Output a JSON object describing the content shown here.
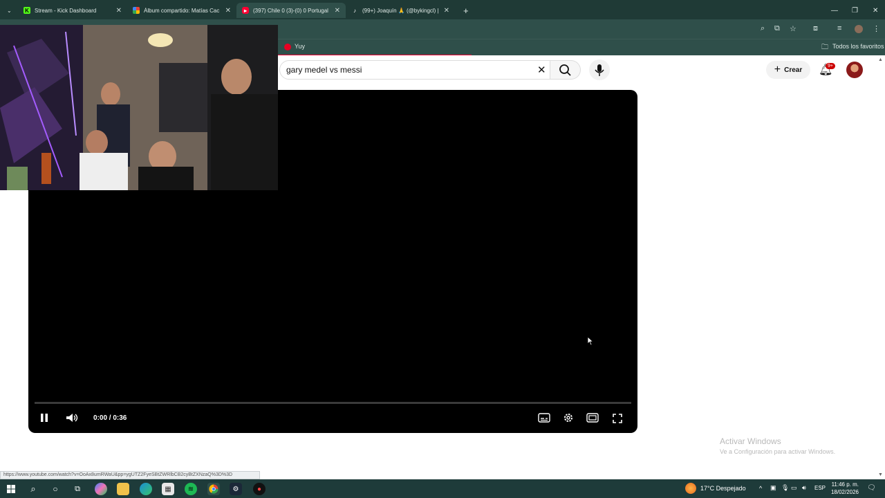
{
  "browser": {
    "tabs": [
      {
        "title": "Stream - Kick Dashboard",
        "favicon": "kick-icon",
        "color": "#53fc18"
      },
      {
        "title": "Álbum compartido: Matías Cac",
        "favicon": "google-photos-icon",
        "color": "#fbbc04"
      },
      {
        "title": "(397) Chile 0 (3)-(0) 0 Portugal",
        "favicon": "youtube-icon",
        "color": "#ff0033"
      },
      {
        "title": "(99+) Joaquín 🙏 (@bykingcl) |",
        "favicon": "tiktok-icon",
        "color": "#000000"
      }
    ],
    "bookmark": "Yuy",
    "all_bookmarks": "Todos los favoritos"
  },
  "youtube": {
    "search_query": "gary medel vs messi",
    "create_label": "Crear",
    "notifications": "9+"
  },
  "player": {
    "time": "0:00 / 0:36",
    "progress": 0.0
  },
  "watermark": {
    "title": "Activar Windows",
    "subtitle": "Ve a Configuración para activar Windows."
  },
  "status_url": "https://www.youtube.com/watch?v=OoAx8umRWaU&pp=ygUTZ2FyeSBtZWRlbCB2cyBtZXNzaQ%3D%3D",
  "taskbar": {
    "weather": "17°C  Despejado",
    "lang": "ESP",
    "time": "11:46 p. m.",
    "date": "18/02/2026"
  }
}
